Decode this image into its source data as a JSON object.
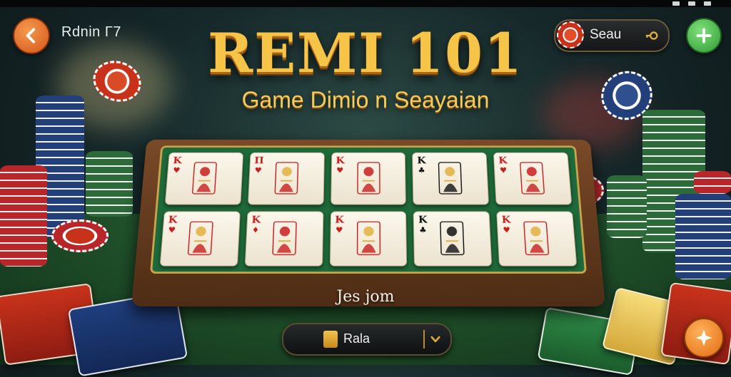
{
  "header": {
    "back_icon": "arrow-left-icon",
    "label": "Rdnin Γ7",
    "seat": {
      "label": "Seau",
      "chip_icon": "poker-chip-icon",
      "key_icon": "key-icon"
    },
    "plus_icon": "plus-icon"
  },
  "title": "REMI 101",
  "subtitle": "Game Dimio n Seayaian",
  "board": {
    "cards": [
      {
        "index": "K",
        "suit": "♥",
        "color": "red",
        "art": "king-of-hearts"
      },
      {
        "index": "Π",
        "suit": "♥",
        "color": "red",
        "art": "spade-figure"
      },
      {
        "index": "K",
        "suit": "♥",
        "color": "red",
        "art": "queen-figure"
      },
      {
        "index": "K",
        "suit": "♣",
        "color": "black",
        "art": "clubs-figure"
      },
      {
        "index": "K",
        "suit": "♥",
        "color": "red",
        "art": "jack-figure"
      },
      {
        "index": "K",
        "suit": "♥",
        "color": "red",
        "art": "king-figure"
      },
      {
        "index": "K",
        "suit": "♦",
        "color": "red",
        "art": "red-pattern"
      },
      {
        "index": "K",
        "suit": "♥",
        "color": "red",
        "art": "queen-figure"
      },
      {
        "index": "K",
        "suit": "♣",
        "color": "black",
        "art": "black-pattern"
      },
      {
        "index": "K",
        "suit": "♥",
        "color": "red",
        "art": "jack-figure"
      }
    ]
  },
  "join_text": "Jes jom",
  "select": {
    "label": "Rala",
    "icon": "card-stack-icon",
    "chevron": "chevron-down-icon"
  },
  "action_icon": "star-icon",
  "colors": {
    "gold": "#f6c548",
    "felt": "#1e6a3a",
    "accent_orange": "#e26a12",
    "accent_green": "#2f9a34"
  }
}
